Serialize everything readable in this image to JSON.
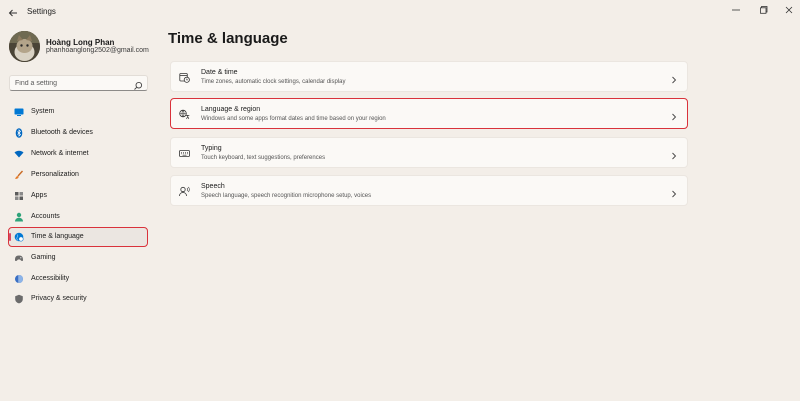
{
  "window": {
    "title": "Settings"
  },
  "profile": {
    "name": "Hoàng Long Phan",
    "email": "phanhoanglong2502@gmail.com"
  },
  "search": {
    "placeholder": "Find a setting"
  },
  "sidebar": {
    "items": [
      {
        "label": "System",
        "icon": "monitor-icon",
        "color": "#0078d4"
      },
      {
        "label": "Bluetooth & devices",
        "icon": "bluetooth-icon",
        "color": "#0067c0"
      },
      {
        "label": "Network & internet",
        "icon": "wifi-icon",
        "color": "#0067c0"
      },
      {
        "label": "Personalization",
        "icon": "brush-icon",
        "color": "#e57c2b"
      },
      {
        "label": "Apps",
        "icon": "apps-icon",
        "color": "#5c5c5c"
      },
      {
        "label": "Accounts",
        "icon": "person-icon",
        "color": "#2fa37a"
      },
      {
        "label": "Time & language",
        "icon": "globe-clock-icon",
        "color": "#0078d4",
        "selected": true
      },
      {
        "label": "Gaming",
        "icon": "gamepad-icon",
        "color": "#6b6b6b"
      },
      {
        "label": "Accessibility",
        "icon": "accessibility-icon",
        "color": "#3a6fc4"
      },
      {
        "label": "Privacy & security",
        "icon": "shield-icon",
        "color": "#6b6b6b"
      }
    ]
  },
  "main": {
    "title": "Time & language",
    "cards": [
      {
        "title": "Date & time",
        "subtitle": "Time zones, automatic clock settings, calendar display",
        "icon": "clock-calendar-icon"
      },
      {
        "title": "Language & region",
        "subtitle": "Windows and some apps format dates and time based on your region",
        "icon": "language-icon",
        "highlighted": true
      },
      {
        "title": "Typing",
        "subtitle": "Touch keyboard, text suggestions, preferences",
        "icon": "keyboard-icon"
      },
      {
        "title": "Speech",
        "subtitle": "Speech language, speech recognition microphone setup, voices",
        "icon": "speech-icon"
      }
    ]
  },
  "colors": {
    "accent": "#0078d4",
    "highlight": "#d9323b",
    "background": "#f3eee8",
    "card": "#fbf9f6"
  }
}
